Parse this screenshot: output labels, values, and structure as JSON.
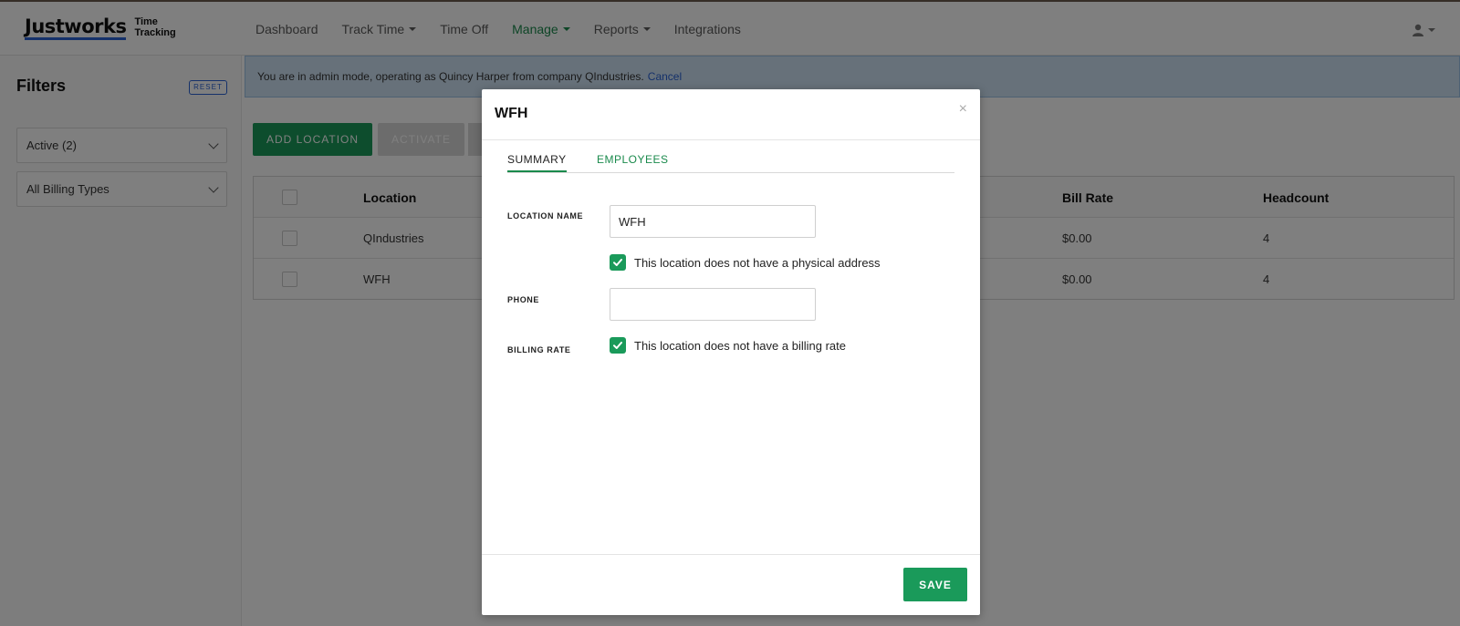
{
  "app": {
    "logo": "Justworks",
    "logo_sub_line1": "Time",
    "logo_sub_line2": "Tracking"
  },
  "nav": {
    "items": [
      {
        "label": "Dashboard",
        "dropdown": false,
        "active": false
      },
      {
        "label": "Track Time",
        "dropdown": true,
        "active": false
      },
      {
        "label": "Time Off",
        "dropdown": false,
        "active": false
      },
      {
        "label": "Manage",
        "dropdown": true,
        "active": true
      },
      {
        "label": "Reports",
        "dropdown": true,
        "active": false
      },
      {
        "label": "Integrations",
        "dropdown": false,
        "active": false
      }
    ]
  },
  "sidebar": {
    "title": "Filters",
    "reset_label": "RESET",
    "status_filter": "Active (2)",
    "billing_filter": "All Billing Types"
  },
  "banner": {
    "text": "You are in admin mode, operating as Quincy Harper from company QIndustries.",
    "cancel_label": "Cancel"
  },
  "toolbar": {
    "add_location_label": "ADD LOCATION",
    "activate_label": "ACTIVATE"
  },
  "table": {
    "headers": {
      "location": "Location",
      "bill_rate": "Bill Rate",
      "headcount": "Headcount"
    },
    "rows": [
      {
        "location": "QIndustries",
        "bill_rate": "$0.00",
        "headcount": "4"
      },
      {
        "location": "WFH",
        "bill_rate": "$0.00",
        "headcount": "4"
      }
    ]
  },
  "modal": {
    "title": "WFH",
    "close_glyph": "×",
    "tabs": {
      "summary": "SUMMARY",
      "employees": "EMPLOYEES"
    },
    "location_name_label": "LOCATION NAME",
    "location_name_value": "WFH",
    "no_address_label": "This location does not have a physical address",
    "phone_label": "PHONE",
    "phone_value": "",
    "billing_rate_label": "BILLING RATE",
    "no_billing_label": "This location does not have a billing rate",
    "save_label": "SAVE"
  },
  "colors": {
    "accent_green": "#1a9a5a",
    "link_blue": "#2a62d4",
    "banner_bg": "#cfe3f5"
  }
}
